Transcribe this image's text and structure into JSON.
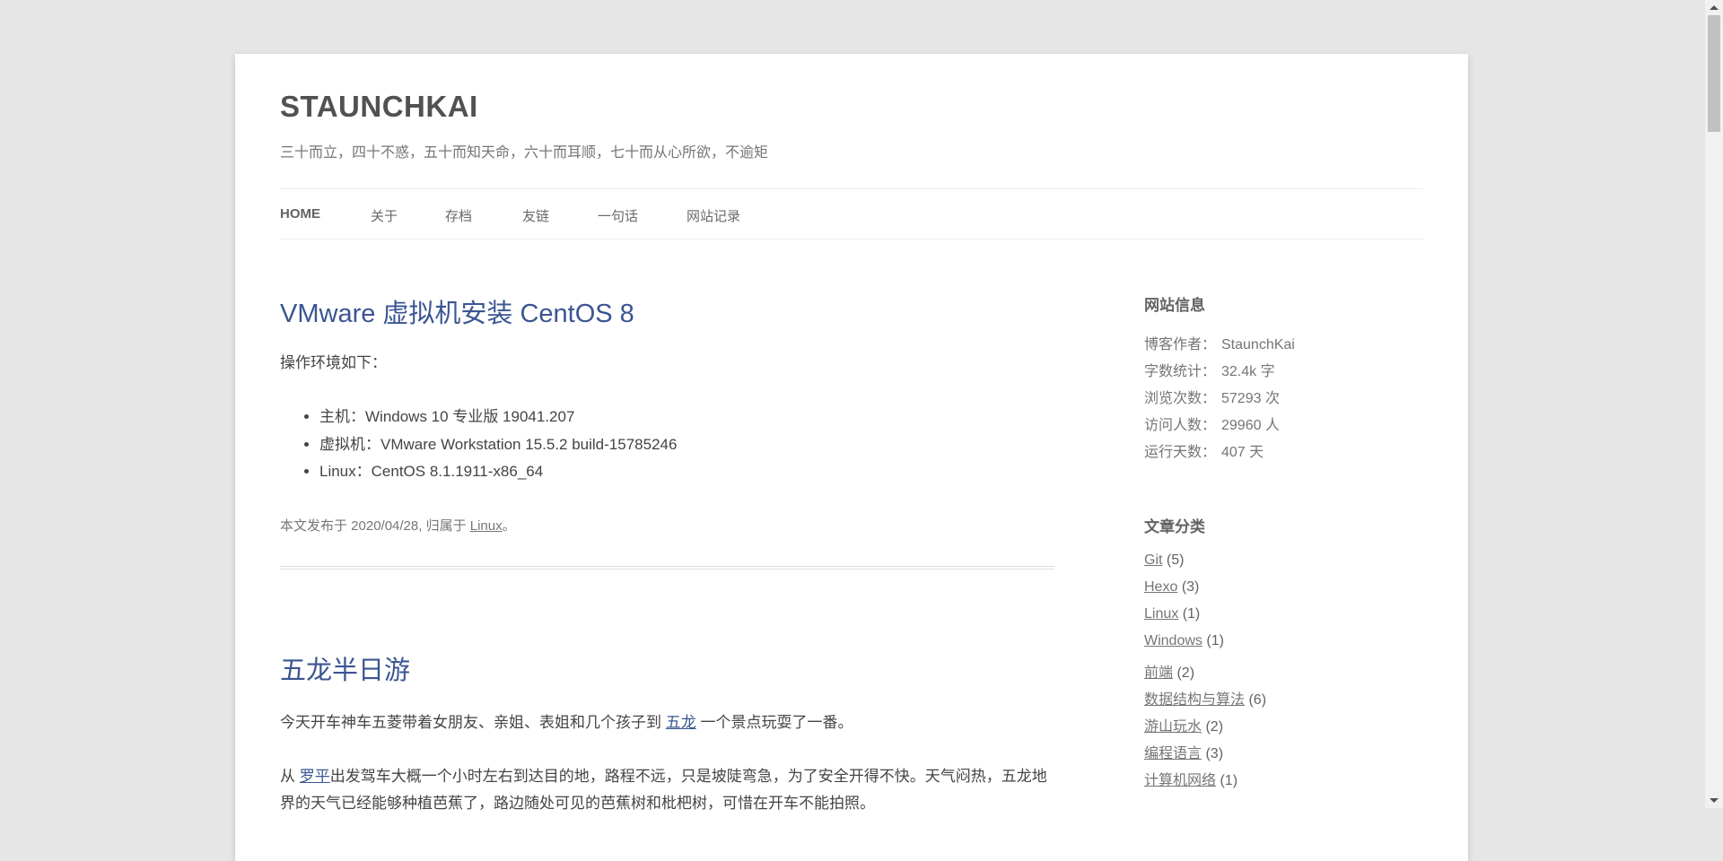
{
  "site": {
    "title": "STAUNCHKAI",
    "tagline": "三十而立，四十不惑，五十而知天命，六十而耳顺，七十而从心所欲，不逾矩"
  },
  "nav": [
    "HOME",
    "关于",
    "存档",
    "友链",
    "一句话",
    "网站记录"
  ],
  "posts": [
    {
      "title": "VMware 虚拟机安装 CentOS 8",
      "intro": "操作环境如下：",
      "items": [
        "主机：Windows 10 专业版 19041.207",
        "虚拟机：VMware Workstation 15.5.2 build-15785246",
        "Linux：CentOS 8.1.1911-x86_64"
      ],
      "meta_prefix": "本文发布于 2020/04/28, 归属于 ",
      "meta_link": "Linux",
      "meta_suffix": "。"
    },
    {
      "title": "五龙半日游",
      "p1_a": "今天开车神车五菱带着女朋友、亲姐、表姐和几个孩子到 ",
      "p1_link": "五龙",
      "p1_b": " 一个景点玩耍了一番。",
      "p2_a": "从 ",
      "p2_link": "罗平",
      "p2_b": "出发驾车大概一个小时左右到达目的地，路程不远，只是坡陡弯急，为了安全开得不快。天气闷热，五龙地界的天气已经能够种植芭蕉了，路边随处可见的芭蕉树和枇杷树，可惜在开车不能拍照。"
    }
  ],
  "sidebar": {
    "info_title": "网站信息",
    "info": [
      {
        "k": "博客作者：",
        "v": "StaunchKai"
      },
      {
        "k": "字数统计：",
        "v": "32.4k 字"
      },
      {
        "k": "浏览次数：",
        "v": "57293 次"
      },
      {
        "k": "访问人数：",
        "v": "29960 人"
      },
      {
        "k": "运行天数：",
        "v": "407 天"
      }
    ],
    "cat_title": "文章分类",
    "cats": [
      {
        "n": "Git",
        "c": "(5)"
      },
      {
        "n": "Hexo",
        "c": "(3)"
      },
      {
        "n": "Linux",
        "c": "(1)"
      },
      {
        "n": "Windows",
        "c": "(1)"
      },
      {
        "n": "前端",
        "c": "(2)"
      },
      {
        "n": "数据结构与算法",
        "c": "(6)"
      },
      {
        "n": "游山玩水",
        "c": "(2)"
      },
      {
        "n": "编程语言",
        "c": "(3)"
      },
      {
        "n": "计算机网络",
        "c": "(1)"
      }
    ]
  }
}
